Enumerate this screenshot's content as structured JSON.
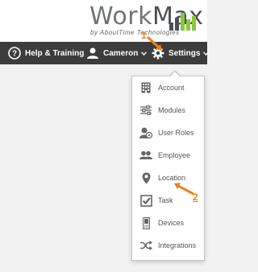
{
  "logo": {
    "work": "Work",
    "max": "Max",
    "subtitle": "by AboutTime Technologies"
  },
  "topbar": {
    "help_label": "Help & Training",
    "user_label": "Cameron",
    "settings_label": "Settings"
  },
  "menu": {
    "items": [
      {
        "label": "Account",
        "icon": "building-icon"
      },
      {
        "label": "Modules",
        "icon": "sliders-icon"
      },
      {
        "label": "User Roles",
        "icon": "user-roles-icon"
      },
      {
        "label": "Employee",
        "icon": "employees-icon"
      },
      {
        "label": "Location",
        "icon": "map-pin-icon"
      },
      {
        "label": "Task",
        "icon": "checkbox-icon"
      },
      {
        "label": "Devices",
        "icon": "phone-icon"
      },
      {
        "label": "Integrations",
        "icon": "shuffle-icon"
      }
    ]
  },
  "annotations": {
    "step1": "1",
    "step2": "2"
  },
  "colors": {
    "topbar": "#3c3c3c",
    "accent": "#f07f1c",
    "logo_bars": "#8cc63f"
  }
}
